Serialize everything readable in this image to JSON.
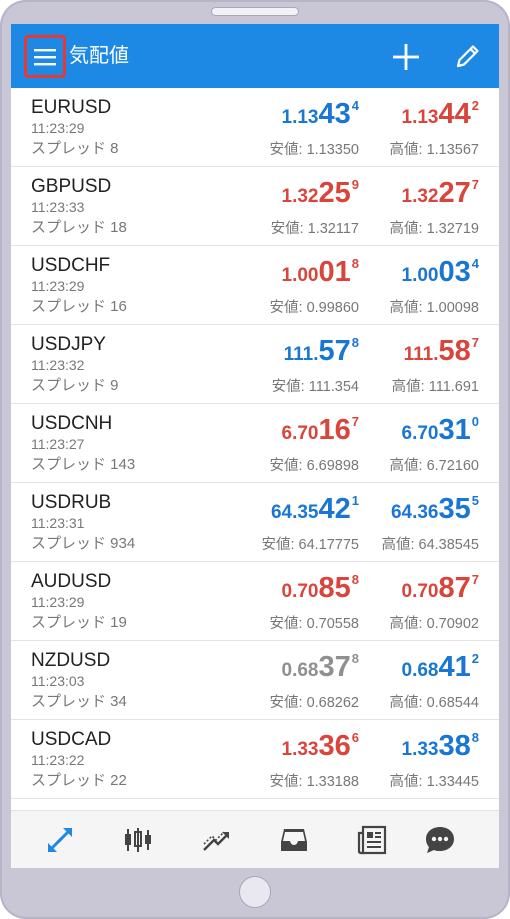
{
  "app": {
    "title": "気配値"
  },
  "colors": {
    "appbar": "#1e88e5",
    "bid_up": "#1976d2",
    "down": "#d9443b",
    "neutral": "#8f8f8f",
    "nav_active": "#1e88e5",
    "nav_inactive": "#444444"
  },
  "icons": {
    "menu": "menu-icon",
    "add": "plus-icon",
    "edit": "pencil-icon",
    "nav": [
      "quotes-icon",
      "chart-icon",
      "trade-icon",
      "history-icon",
      "news-icon",
      "chat-icon"
    ]
  },
  "quotes": [
    {
      "symbol": "EURUSD",
      "time": "11:23:29",
      "spread": "スプレッド 8",
      "bid": {
        "base": "1.13",
        "big": "43",
        "sup": "4",
        "color": "blue"
      },
      "ask": {
        "base": "1.13",
        "big": "44",
        "sup": "2",
        "color": "red"
      },
      "low": "安値: 1.13350",
      "high": "高値: 1.13567"
    },
    {
      "symbol": "GBPUSD",
      "time": "11:23:33",
      "spread": "スプレッド 18",
      "bid": {
        "base": "1.32",
        "big": "25",
        "sup": "9",
        "color": "red"
      },
      "ask": {
        "base": "1.32",
        "big": "27",
        "sup": "7",
        "color": "red"
      },
      "low": "安値: 1.32117",
      "high": "高値: 1.32719"
    },
    {
      "symbol": "USDCHF",
      "time": "11:23:29",
      "spread": "スプレッド 16",
      "bid": {
        "base": "1.00",
        "big": "01",
        "sup": "8",
        "color": "red"
      },
      "ask": {
        "base": "1.00",
        "big": "03",
        "sup": "4",
        "color": "blue"
      },
      "low": "安値: 0.99860",
      "high": "高値: 1.00098"
    },
    {
      "symbol": "USDJPY",
      "time": "11:23:32",
      "spread": "スプレッド 9",
      "bid": {
        "base": "111.",
        "big": "57",
        "sup": "8",
        "color": "blue"
      },
      "ask": {
        "base": "111.",
        "big": "58",
        "sup": "7",
        "color": "red"
      },
      "low": "安値: 111.354",
      "high": "高値: 111.691"
    },
    {
      "symbol": "USDCNH",
      "time": "11:23:27",
      "spread": "スプレッド 143",
      "bid": {
        "base": "6.70",
        "big": "16",
        "sup": "7",
        "color": "red"
      },
      "ask": {
        "base": "6.70",
        "big": "31",
        "sup": "0",
        "color": "blue"
      },
      "low": "安値: 6.69898",
      "high": "高値: 6.72160"
    },
    {
      "symbol": "USDRUB",
      "time": "11:23:31",
      "spread": "スプレッド 934",
      "bid": {
        "base": "64.35",
        "big": "42",
        "sup": "1",
        "color": "blue"
      },
      "ask": {
        "base": "64.36",
        "big": "35",
        "sup": "5",
        "color": "blue"
      },
      "low": "安値: 64.17775",
      "high": "高値: 64.38545"
    },
    {
      "symbol": "AUDUSD",
      "time": "11:23:29",
      "spread": "スプレッド 19",
      "bid": {
        "base": "0.70",
        "big": "85",
        "sup": "8",
        "color": "red"
      },
      "ask": {
        "base": "0.70",
        "big": "87",
        "sup": "7",
        "color": "red"
      },
      "low": "安値: 0.70558",
      "high": "高値: 0.70902"
    },
    {
      "symbol": "NZDUSD",
      "time": "11:23:03",
      "spread": "スプレッド 34",
      "bid": {
        "base": "0.68",
        "big": "37",
        "sup": "8",
        "color": "gray"
      },
      "ask": {
        "base": "0.68",
        "big": "41",
        "sup": "2",
        "color": "blue"
      },
      "low": "安値: 0.68262",
      "high": "高値: 0.68544"
    },
    {
      "symbol": "USDCAD",
      "time": "11:23:22",
      "spread": "スプレッド 22",
      "bid": {
        "base": "1.33",
        "big": "36",
        "sup": "6",
        "color": "red"
      },
      "ask": {
        "base": "1.33",
        "big": "38",
        "sup": "8",
        "color": "blue"
      },
      "low": "安値: 1.33188",
      "high": "高値: 1.33445"
    }
  ]
}
